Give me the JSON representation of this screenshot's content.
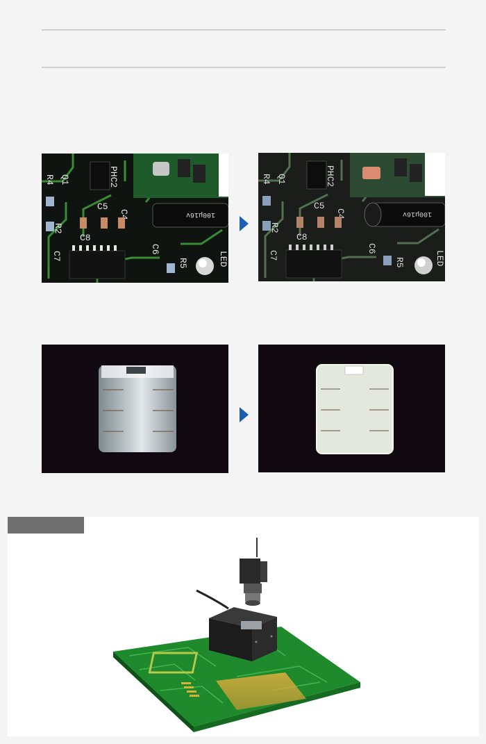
{
  "section": {
    "heading": "",
    "tag_label": ""
  },
  "colors": {
    "background": "#f4f4f4",
    "rule": "#cfcfcf",
    "arrow": "#1a5fb4",
    "tab": "#6f6f6f",
    "pcb_green": "#1f8a2c",
    "camera_body": "#2a2a2a"
  },
  "icons": {
    "arrow_1": "arrow-right-icon",
    "arrow_2": "arrow-right-icon"
  },
  "pcb_labels": [
    "PHC2",
    "Q1",
    "R4",
    "R2",
    "C8",
    "C4",
    "C5",
    "C6",
    "C7",
    "R5",
    "LED",
    "100μ16v"
  ]
}
